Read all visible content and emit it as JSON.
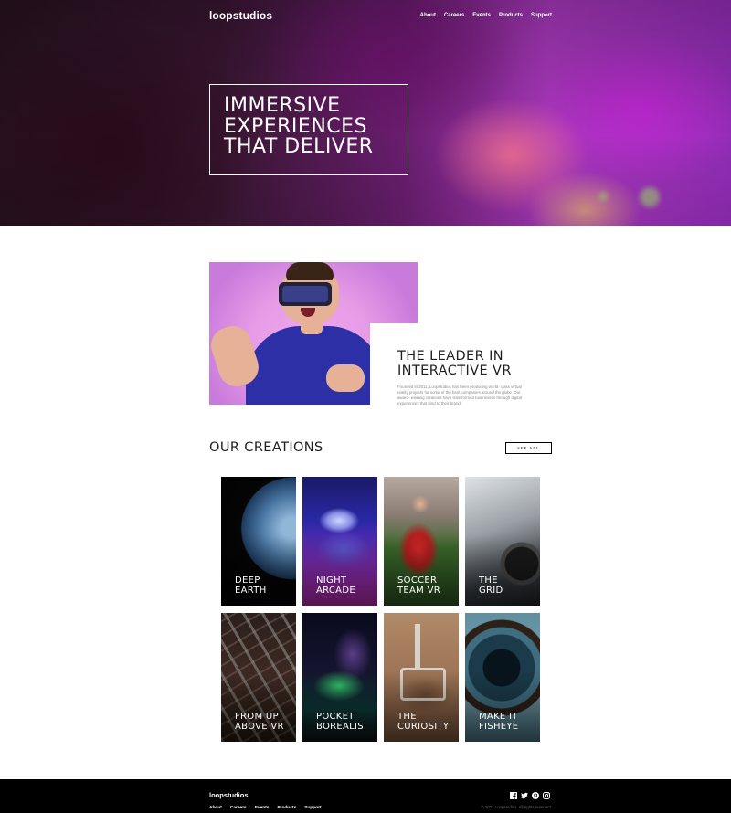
{
  "brand": "loopstudios",
  "nav": [
    "About",
    "Careers",
    "Events",
    "Products",
    "Support"
  ],
  "hero": {
    "title_lines": [
      "IMMERSIVE",
      "EXPERIENCES",
      "THAT DELIVER"
    ]
  },
  "leader": {
    "title_lines": [
      "THE LEADER IN",
      "INTERACTIVE VR"
    ],
    "text": "Founded in 2011, Loopstudios has been producing world- class virtual reality projects for some of the best companies around the globe. Our award- winning creations have transformed businesses through digital experiences that bind to their brand."
  },
  "creations": {
    "title": "OUR CREATIONS",
    "see_all_label": "SEE ALL",
    "items": [
      {
        "line1": "DEEP",
        "line2": "EARTH"
      },
      {
        "line1": "NIGHT",
        "line2": "ARCADE"
      },
      {
        "line1": "SOCCER",
        "line2": "TEAM VR"
      },
      {
        "line1": "THE",
        "line2": "GRID"
      },
      {
        "line1": "FROM UP",
        "line2": "ABOVE VR"
      },
      {
        "line1": "POCKET",
        "line2": "BOREALIS"
      },
      {
        "line1": "THE",
        "line2": "CURIOSITY"
      },
      {
        "line1": "MAKE IT",
        "line2": "FISHEYE"
      }
    ]
  },
  "footer": {
    "brand": "loopstudios",
    "nav": [
      "About",
      "Careers",
      "Events",
      "Products",
      "Support"
    ],
    "socials": [
      "facebook-icon",
      "twitter-icon",
      "pinterest-icon",
      "instagram-icon"
    ],
    "copyright": "© 2021 Loopstudios. All rights reserved."
  },
  "colors": {
    "footer_bg": "#000000",
    "heading": "#1f1f1f",
    "body_text": "#8a8a8a"
  }
}
